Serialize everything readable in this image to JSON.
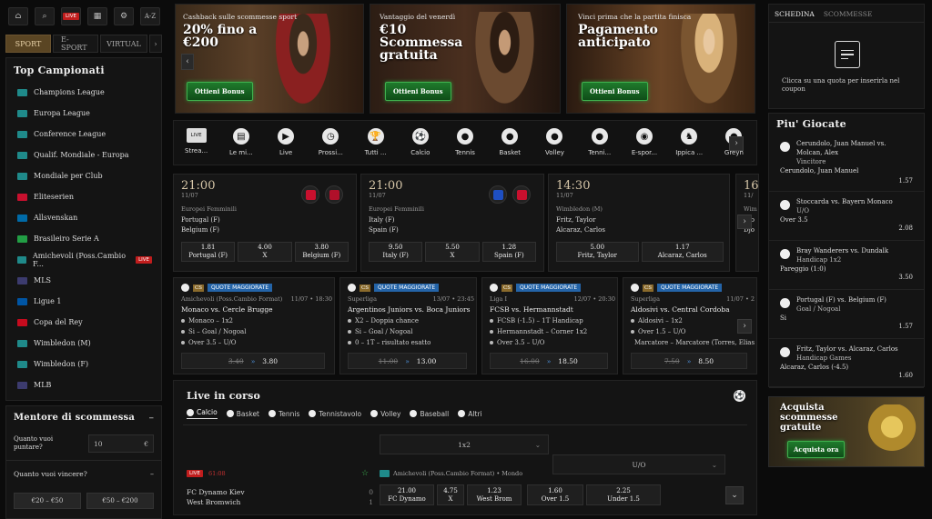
{
  "topbar": {
    "live_label": "LIVE",
    "az_label": "A-Z"
  },
  "sports_tabs": [
    "SPORT",
    "E-SPORT",
    "VIRTUAL"
  ],
  "top_campionati": {
    "title": "Top Campionati",
    "leagues": [
      {
        "name": "Champions League",
        "flag": "#1f8a8a"
      },
      {
        "name": "Europa League",
        "flag": "#1f8a8a"
      },
      {
        "name": "Conference League",
        "flag": "#1f8a8a"
      },
      {
        "name": "Qualif. Mondiale - Europa",
        "flag": "#1f8a8a"
      },
      {
        "name": "Mondiale per Club",
        "flag": "#1f8a8a"
      },
      {
        "name": "Eliteserien",
        "flag": "#c8102e"
      },
      {
        "name": "Allsvenskan",
        "flag": "#006aa7"
      },
      {
        "name": "Brasileiro Serie A",
        "flag": "#229e45"
      },
      {
        "name": "Amichevoli (Poss.Cambio F...",
        "flag": "#1f8a8a",
        "live": "LIVE"
      },
      {
        "name": "MLS",
        "flag": "#3c3b6e"
      },
      {
        "name": "Ligue 1",
        "flag": "#0055a4"
      },
      {
        "name": "Copa del Rey",
        "flag": "#c60b1e"
      },
      {
        "name": "Wimbledon (M)",
        "flag": "#1f8a8a"
      },
      {
        "name": "Wimbledon (F)",
        "flag": "#1f8a8a"
      },
      {
        "name": "MLB",
        "flag": "#3c3b6e"
      }
    ]
  },
  "mentore": {
    "title": "Mentore di scommessa",
    "q1": "Quanto vuoi puntare?",
    "stake": "10",
    "currency": "€",
    "q2": "Quanto vuoi vincere?",
    "ranges": [
      "€20 – €50",
      "€50 – €200"
    ]
  },
  "banners": [
    {
      "sub": "Cashback sulle scommesse sport",
      "title": "20% fino a €200",
      "btn": "Ottieni Bonus"
    },
    {
      "sub": "Vantaggio del venerdì",
      "title": "€10 Scommessa gratuita",
      "btn": "Ottieni Bonus"
    },
    {
      "sub": "Vinci prima che la partita finisca",
      "title": "Pagamento anticipato",
      "btn": "Ottieni Bonus"
    }
  ],
  "categories": [
    {
      "label": "Strea...",
      "icon": "LIVE"
    },
    {
      "label": "Le mi...",
      "icon": "▤"
    },
    {
      "label": "Live",
      "icon": "▶"
    },
    {
      "label": "Prossi...",
      "icon": "◷"
    },
    {
      "label": "Tutti ...",
      "icon": "🏆"
    },
    {
      "label": "Calcio",
      "icon": "⚽"
    },
    {
      "label": "Tennis",
      "icon": "●"
    },
    {
      "label": "Basket",
      "icon": "●"
    },
    {
      "label": "Volley",
      "icon": "●"
    },
    {
      "label": "Tenni...",
      "icon": "●"
    },
    {
      "label": "E-spor...",
      "icon": "◉"
    },
    {
      "label": "Ippica ...",
      "icon": "♞"
    },
    {
      "label": "Greyh",
      "icon": "●"
    }
  ],
  "matches": [
    {
      "time": "21:00",
      "date": "11/07",
      "league": "Europei Femminili",
      "t1": "Portugal (F)",
      "t2": "Belgium (F)",
      "kit1": "#c8102e",
      "kit2": "#b0102a",
      "odds": [
        {
          "v": "1.81",
          "l": "Portugal (F)"
        },
        {
          "v": "4.00",
          "l": "X"
        },
        {
          "v": "3.80",
          "l": "Belgium (F)"
        }
      ]
    },
    {
      "time": "21:00",
      "date": "11/07",
      "league": "Europei Femminili",
      "t1": "Italy (F)",
      "t2": "Spain (F)",
      "kit1": "#1e4fc2",
      "kit2": "#c8102e",
      "odds": [
        {
          "v": "9.50",
          "l": "Italy (F)"
        },
        {
          "v": "5.50",
          "l": "X"
        },
        {
          "v": "1.28",
          "l": "Spain (F)"
        }
      ]
    },
    {
      "time": "14:30",
      "date": "11/07",
      "league": "Wimbledon (M)",
      "t1": "Fritz, Taylor",
      "t2": "Alcaraz, Carlos",
      "odds": [
        {
          "v": "5.00",
          "l": "Fritz, Taylor"
        },
        {
          "v": "1.17",
          "l": "Alcaraz, Carlos"
        }
      ]
    },
    {
      "time": "16:",
      "date": "11/",
      "league": "Wim",
      "t1": "Djo",
      "t2": "Djo"
    }
  ],
  "boosts": [
    {
      "badge": "QUOTE MAGGIORATE",
      "league": "Amichevoli (Poss.Cambio Format)",
      "date": "11/07 • 18:30",
      "match": "Monaco vs. Cercle Brugge",
      "lines": [
        "Monaco – 1x2",
        "Si – Goal / Nogoal",
        "Over 3.5 – U/O"
      ],
      "old": "3.40",
      "new": "3.80"
    },
    {
      "badge": "QUOTE MAGGIORATE",
      "league": "Superliga",
      "date": "13/07 • 23:45",
      "match": "Argentinos Juniors vs. Boca Juniors",
      "lines": [
        "X2 – Doppia chance",
        "Si – Goal / Nogoal",
        "0 – 1T – risultato esatto"
      ],
      "old": "11.00",
      "new": "13.00"
    },
    {
      "badge": "QUOTE MAGGIORATE",
      "league": "Liga I",
      "date": "12/07 • 20:30",
      "match": "FCSB vs. Hermannstadt",
      "lines": [
        "FCSB (-1.5) – 1T Handicap",
        "Hermannstadt – Corner 1x2",
        "Over 3.5 – U/O"
      ],
      "old": "16.00",
      "new": "18.50"
    },
    {
      "badge": "QUOTE MAGGIORATE",
      "league": "Superliga",
      "date": "11/07 • 2",
      "match": "Aldosivi vs. Central Cordoba",
      "lines": [
        "Aldosivi – 1x2",
        "Over 1.5 – U/O",
        "Marcatore – Marcatore (Torres, Elias Da"
      ],
      "old": "7.50",
      "new": "8.50"
    }
  ],
  "live": {
    "title": "Live in corso",
    "tabs": [
      "Calcio",
      "Basket",
      "Tennis",
      "Tennistavolo",
      "Volley",
      "Baseball",
      "Altri"
    ],
    "sel1": "1x2",
    "sel2": "U/O",
    "match": {
      "badge": "LIVE",
      "minute": "61:08",
      "league": "Amichevoli (Poss.Cambio Format) • Mondo",
      "t1": "FC Dynamo Kiev",
      "t2": "West Bromwich",
      "s1": "0",
      "s2": "1",
      "odds": [
        {
          "v": "21.00",
          "l": "FC Dynamo"
        },
        {
          "v": "4.75",
          "l": "X"
        },
        {
          "v": "1.23",
          "l": "West Brom"
        },
        {
          "v": "1.60",
          "l": "Over 1.5"
        },
        {
          "v": "2.25",
          "l": "Under 1.5"
        }
      ]
    }
  },
  "betslip": {
    "tab1": "SCHEDINA",
    "tab2": "SCOMMESSE",
    "hint": "Clicca su una quota per inserirla nel coupon"
  },
  "piu_giocate": {
    "title": "Piu' Giocate",
    "items": [
      {
        "match": "Cerundolo, Juan Manuel vs. Molcan, Alex",
        "market": "Vincitore",
        "pick": "Cerundolo, Juan Manuel",
        "odd": "1.57"
      },
      {
        "match": "Stoccarda vs. Bayern Monaco",
        "market": "U/O",
        "pick": "Over 3.5",
        "odd": "2.08"
      },
      {
        "match": "Bray Wanderers vs. Dundalk",
        "market": "Handicap 1x2",
        "pick": "Pareggio (1:0)",
        "odd": "3.50"
      },
      {
        "match": "Portugal (F) vs. Belgium (F)",
        "market": "Goal / Nogoal",
        "pick": "Si",
        "odd": "1.57"
      },
      {
        "match": "Fritz, Taylor vs. Alcaraz, Carlos",
        "market": "Handicap Games",
        "pick": "Alcaraz, Carlos (-4.5)",
        "odd": "1.60"
      }
    ]
  },
  "promo": {
    "title": "Acquista scommesse gratuite",
    "btn": "Acquista ora"
  }
}
